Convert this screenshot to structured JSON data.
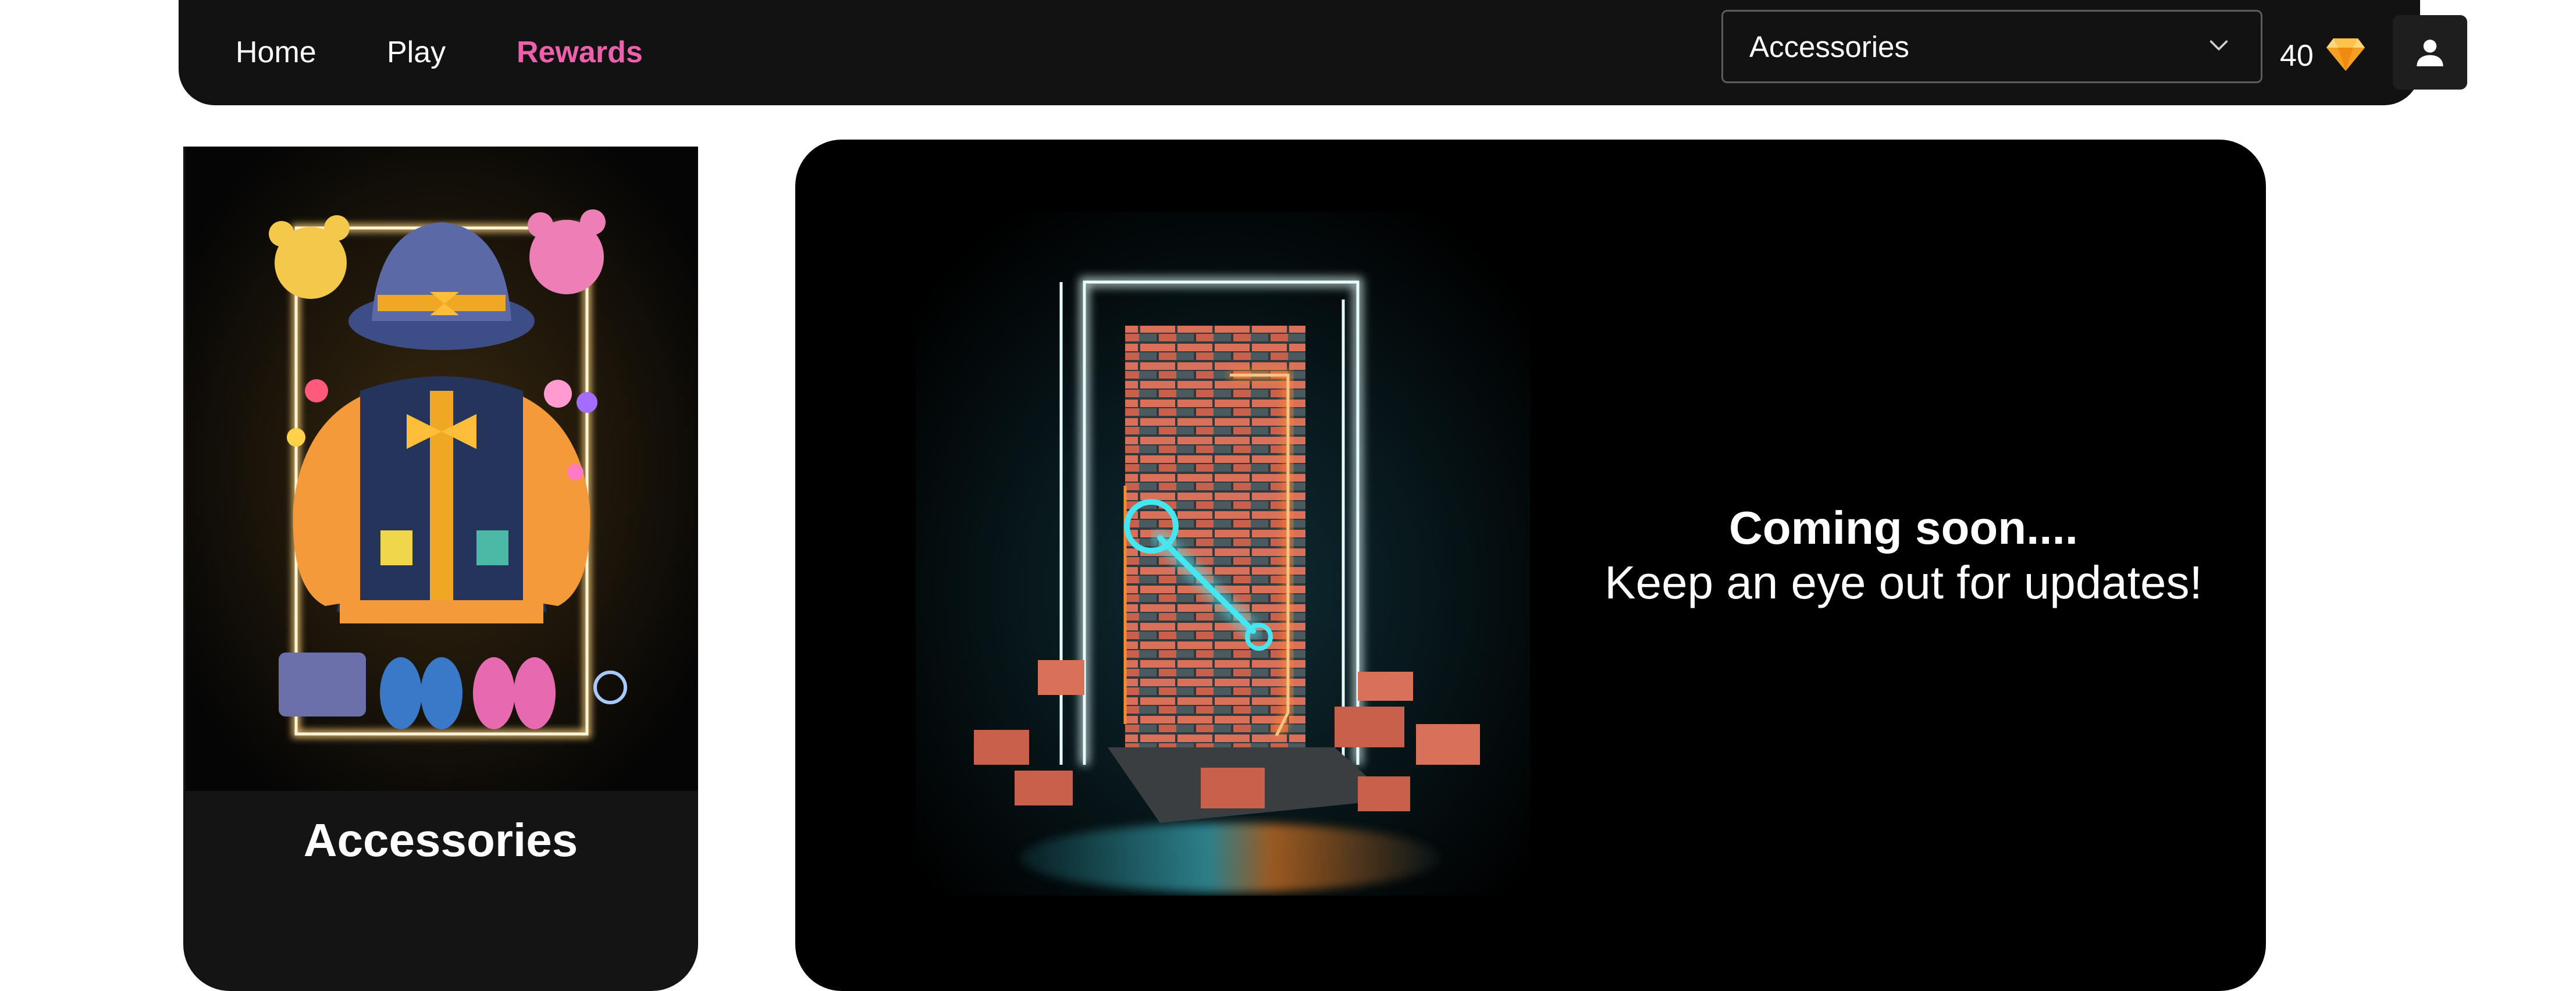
{
  "nav": {
    "links": [
      {
        "label": "Home",
        "active": false
      },
      {
        "label": "Play",
        "active": false
      },
      {
        "label": "Rewards",
        "active": true
      }
    ],
    "category_select": {
      "value": "Accessories"
    },
    "gems": {
      "count": "40",
      "icon": "gem-icon"
    },
    "icons": {
      "profile": "user-icon",
      "settings": "gear-icon"
    }
  },
  "category_card": {
    "title": "Accessories"
  },
  "info_panel": {
    "title": "Coming soon....",
    "subtitle": "Keep an eye out for updates!"
  },
  "colors": {
    "active_link": "#ee5fae",
    "navbar_bg": "#121212",
    "neon_cyan": "#46e6f0",
    "neon_orange": "#ff8a2a"
  }
}
